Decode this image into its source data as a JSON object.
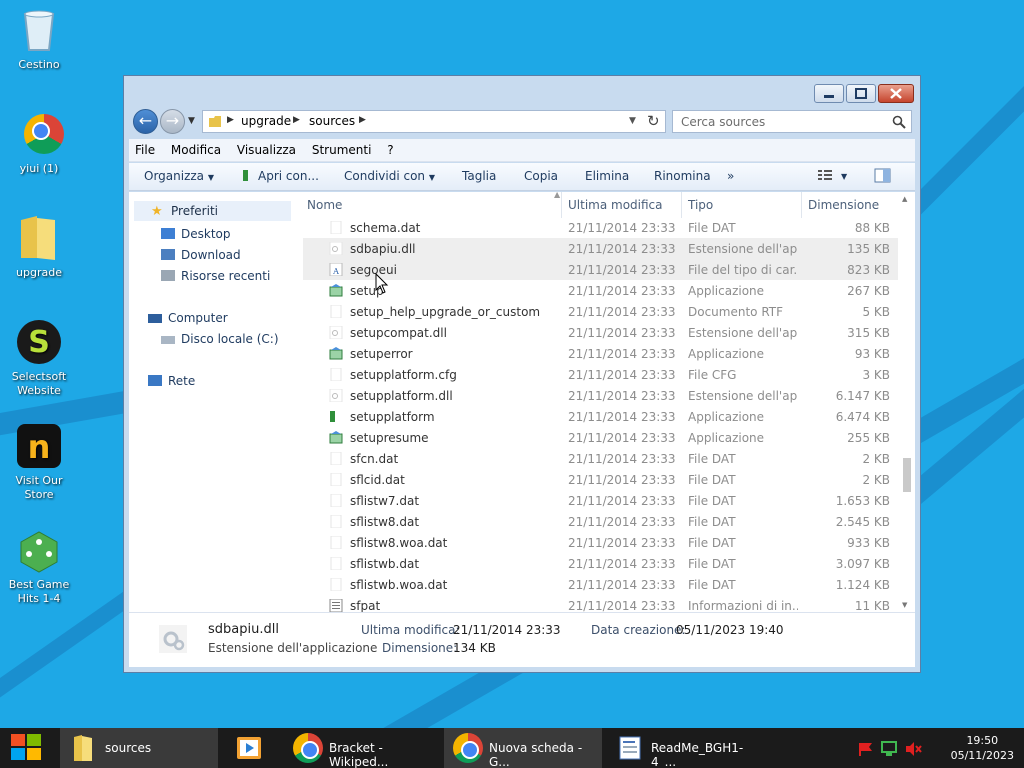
{
  "desktop": {
    "icons": [
      {
        "label": "Cestino"
      },
      {
        "label": "yiui (1)"
      },
      {
        "label": "upgrade"
      },
      {
        "label": "Selectsoft Website"
      },
      {
        "label": "Visit Our Store"
      },
      {
        "label": "Best Game Hits 1-4"
      }
    ]
  },
  "window": {
    "address": {
      "parts": [
        "upgrade",
        "sources"
      ]
    },
    "search_placeholder": "Cerca sources",
    "menu": [
      "File",
      "Modifica",
      "Visualizza",
      "Strumenti",
      "?"
    ],
    "toolbar": {
      "organize": "Organizza",
      "open_with": "Apri con...",
      "share": "Condividi con",
      "cut": "Taglia",
      "copy": "Copia",
      "delete": "Elimina",
      "rename": "Rinomina",
      "more": "»"
    },
    "nav": {
      "favorites": "Preferiti",
      "desktop": "Desktop",
      "download": "Download",
      "recent": "Risorse recenti",
      "computer": "Computer",
      "local_disk": "Disco locale (C:)",
      "network": "Rete"
    },
    "columns": {
      "name": "Nome",
      "date": "Ultima modifica",
      "type": "Tipo",
      "size": "Dimensione"
    },
    "files": [
      {
        "name": "schema.dat",
        "date": "21/11/2014 23:33",
        "type": "File DAT",
        "size": "88 KB",
        "icon": "file"
      },
      {
        "name": "sdbapiu.dll",
        "date": "21/11/2014 23:33",
        "type": "Estensione dell'ap...",
        "size": "135 KB",
        "icon": "dll"
      },
      {
        "name": "segoeui",
        "date": "21/11/2014 23:33",
        "type": "File del tipo di car...",
        "size": "823 KB",
        "icon": "font"
      },
      {
        "name": "setup",
        "date": "21/11/2014 23:33",
        "type": "Applicazione",
        "size": "267 KB",
        "icon": "app"
      },
      {
        "name": "setup_help_upgrade_or_custom",
        "date": "21/11/2014 23:33",
        "type": "Documento RTF",
        "size": "5 KB",
        "icon": "file"
      },
      {
        "name": "setupcompat.dll",
        "date": "21/11/2014 23:33",
        "type": "Estensione dell'ap...",
        "size": "315 KB",
        "icon": "dll"
      },
      {
        "name": "setuperror",
        "date": "21/11/2014 23:33",
        "type": "Applicazione",
        "size": "93 KB",
        "icon": "app"
      },
      {
        "name": "setupplatform.cfg",
        "date": "21/11/2014 23:33",
        "type": "File CFG",
        "size": "3 KB",
        "icon": "file"
      },
      {
        "name": "setupplatform.dll",
        "date": "21/11/2014 23:33",
        "type": "Estensione dell'ap...",
        "size": "6.147 KB",
        "icon": "dll"
      },
      {
        "name": "setupplatform",
        "date": "21/11/2014 23:33",
        "type": "Applicazione",
        "size": "6.474 KB",
        "icon": "app2"
      },
      {
        "name": "setupresume",
        "date": "21/11/2014 23:33",
        "type": "Applicazione",
        "size": "255 KB",
        "icon": "app"
      },
      {
        "name": "sfcn.dat",
        "date": "21/11/2014 23:33",
        "type": "File DAT",
        "size": "2 KB",
        "icon": "file"
      },
      {
        "name": "sflcid.dat",
        "date": "21/11/2014 23:33",
        "type": "File DAT",
        "size": "2 KB",
        "icon": "file"
      },
      {
        "name": "sflistw7.dat",
        "date": "21/11/2014 23:33",
        "type": "File DAT",
        "size": "1.653 KB",
        "icon": "file"
      },
      {
        "name": "sflistw8.dat",
        "date": "21/11/2014 23:33",
        "type": "File DAT",
        "size": "2.545 KB",
        "icon": "file"
      },
      {
        "name": "sflistw8.woa.dat",
        "date": "21/11/2014 23:33",
        "type": "File DAT",
        "size": "933 KB",
        "icon": "file"
      },
      {
        "name": "sflistwb.dat",
        "date": "21/11/2014 23:33",
        "type": "File DAT",
        "size": "3.097 KB",
        "icon": "file"
      },
      {
        "name": "sflistwb.woa.dat",
        "date": "21/11/2014 23:33",
        "type": "File DAT",
        "size": "1.124 KB",
        "icon": "file"
      },
      {
        "name": "sfpat",
        "date": "21/11/2014 23:33",
        "type": "Informazioni di in...",
        "size": "11 KB",
        "icon": "inf"
      }
    ],
    "details": {
      "filename": "sdbapiu.dll",
      "filetype": "Estensione dell'applicazione",
      "modified_label": "Ultima modifica:",
      "modified_value": "21/11/2014 23:33",
      "created_label": "Data creazione:",
      "created_value": "05/11/2023 19:40",
      "size_label": "Dimensione:",
      "size_value": "134 KB"
    }
  },
  "taskbar": {
    "items": [
      "sources",
      "Bracket - Wikiped...",
      "Nuova scheda - G...",
      "ReadMe_BGH1-4_..."
    ],
    "time": "19:50",
    "date": "05/11/2023"
  }
}
